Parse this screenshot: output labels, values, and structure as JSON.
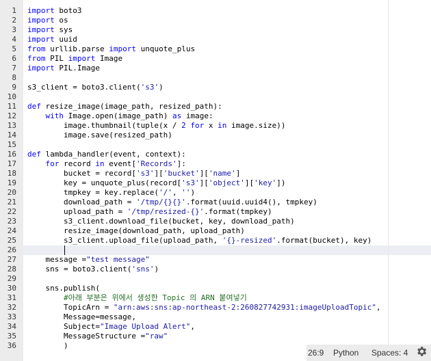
{
  "editor": {
    "cursor_line": 26,
    "lines": [
      "import boto3",
      "import os",
      "import sys",
      "import uuid",
      "from urllib.parse import unquote_plus",
      "from PIL import Image",
      "import PIL.Image",
      "",
      "s3_client = boto3.client('s3')",
      "",
      "def resize_image(image_path, resized_path):",
      "    with Image.open(image_path) as image:",
      "        image.thumbnail(tuple(x / 2 for x in image.size))",
      "        image.save(resized_path)",
      "",
      "def lambda_handler(event, context):",
      "    for record in event['Records']:",
      "        bucket = record['s3']['bucket']['name']",
      "        key = unquote_plus(record['s3']['object']['key'])",
      "        tmpkey = key.replace('/', '')",
      "        download_path = '/tmp/{}{}'.format(uuid.uuid4(), tmpkey)",
      "        upload_path = '/tmp/resized-{}'.format(tmpkey)",
      "        s3_client.download_file(bucket, key, download_path)",
      "        resize_image(download_path, upload_path)",
      "        s3_client.upload_file(upload_path, '{}-resized'.format(bucket), key)",
      "",
      "    message =\"test message\"",
      "    sns = boto3.client('sns')",
      "",
      "    sns.publish(",
      "        #아래 부분은 위에서 생성한 Topic 의 ARN 붙여넣기",
      "        TopicArn = \"arn:aws:sns:ap-northeast-2:260827742931:imageUploadTopic\",",
      "        Message=message,",
      "        Subject=\"Image Upload Alert\",",
      "        MessageStructure =\"raw\"",
      "        )"
    ]
  },
  "statusbar": {
    "position": "26:9",
    "language": "Python",
    "spaces": "Spaces: 4",
    "settings_icon": "gear-icon"
  }
}
